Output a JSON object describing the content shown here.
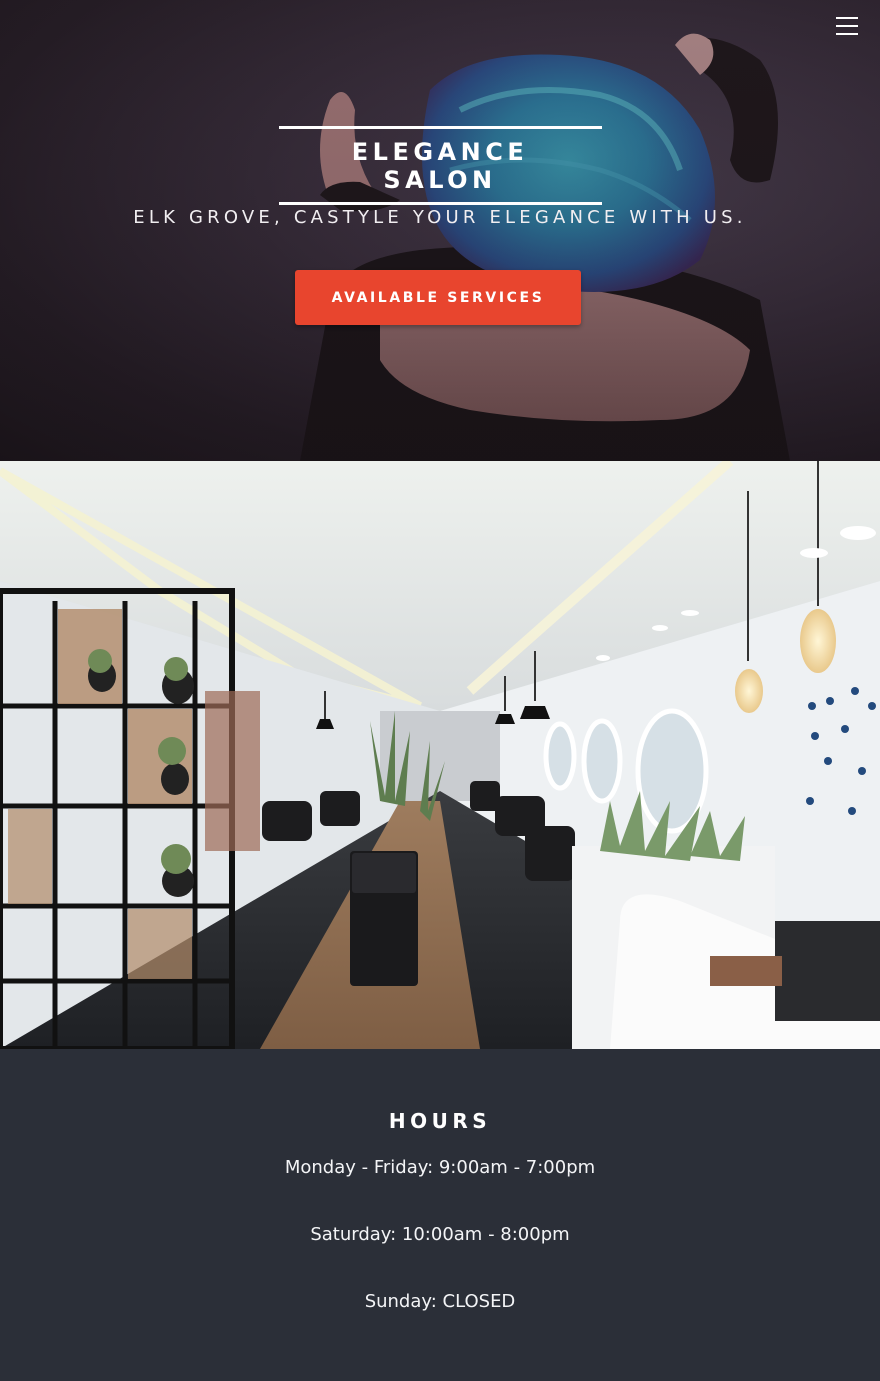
{
  "hero": {
    "brand": "ELEGANCE SALON",
    "tagline": "ELK GROVE, CASTYLE YOUR ELEGANCE WITH US.",
    "cta_label": "AVAILABLE SERVICES",
    "menu_icon": "hamburger-menu-icon",
    "accent_color": "#e8452e"
  },
  "hours": {
    "title": "HOURS",
    "lines": [
      "Monday - Friday: 9:00am - 7:00pm",
      "Saturday: 10:00am - 8:00pm",
      "Sunday: CLOSED"
    ],
    "background_color": "#2b2f38"
  }
}
